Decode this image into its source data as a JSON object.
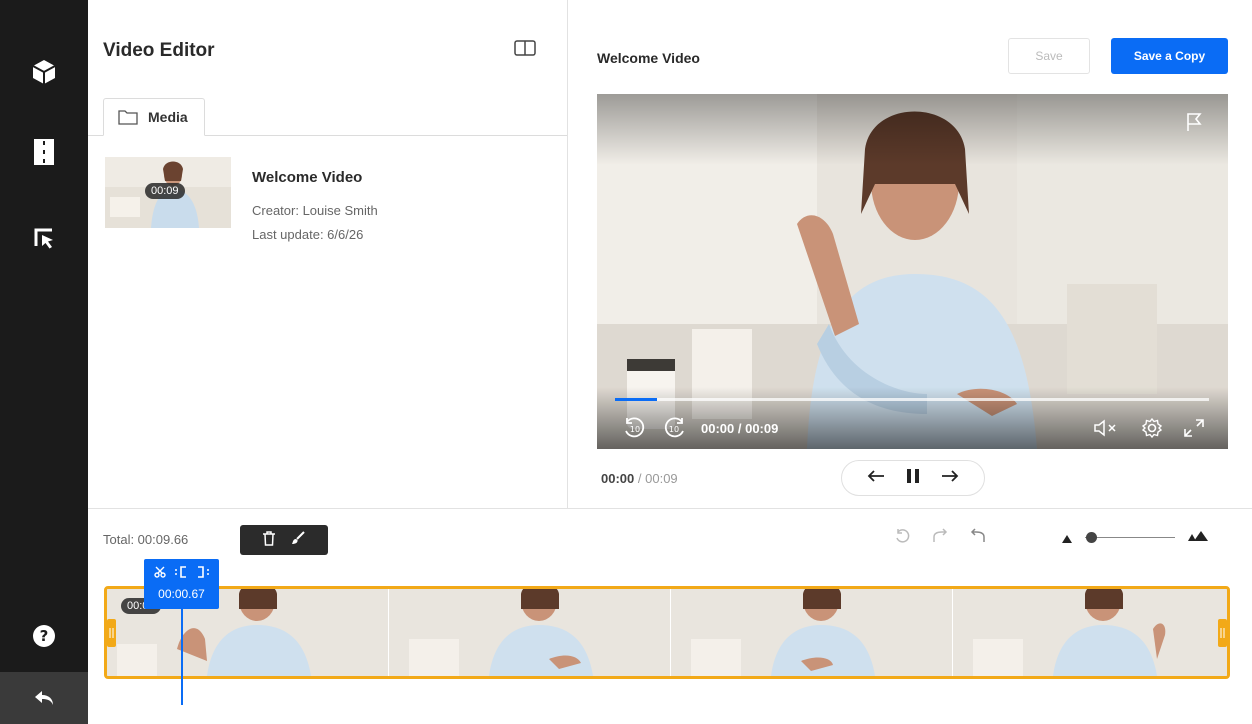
{
  "rail": {
    "icons": [
      "cube-icon",
      "film-icon",
      "select-cursor-icon",
      "help-icon",
      "back-arrow-icon"
    ]
  },
  "media_panel": {
    "title": "Video Editor",
    "tab_label": "Media",
    "item": {
      "title": "Welcome Video",
      "duration": "00:09",
      "creator": "Creator: Louise Smith",
      "last_update": "Last update: 6/6/26"
    }
  },
  "player_panel": {
    "title": "Welcome Video",
    "save_label": "Save",
    "save_copy_label": "Save a Copy",
    "player_time": "00:00 / 00:09",
    "progress": 0.07,
    "current_time": "00:00",
    "separator": "/",
    "total_time": "00:09"
  },
  "timeline": {
    "total_label": "Total: 00:09.66",
    "clip_badge": "00:09",
    "cut_time": "00:00.67"
  },
  "colors": {
    "accent": "#0a6cf5",
    "clip_border": "#f2a918",
    "rail": "#1b1b1b"
  }
}
